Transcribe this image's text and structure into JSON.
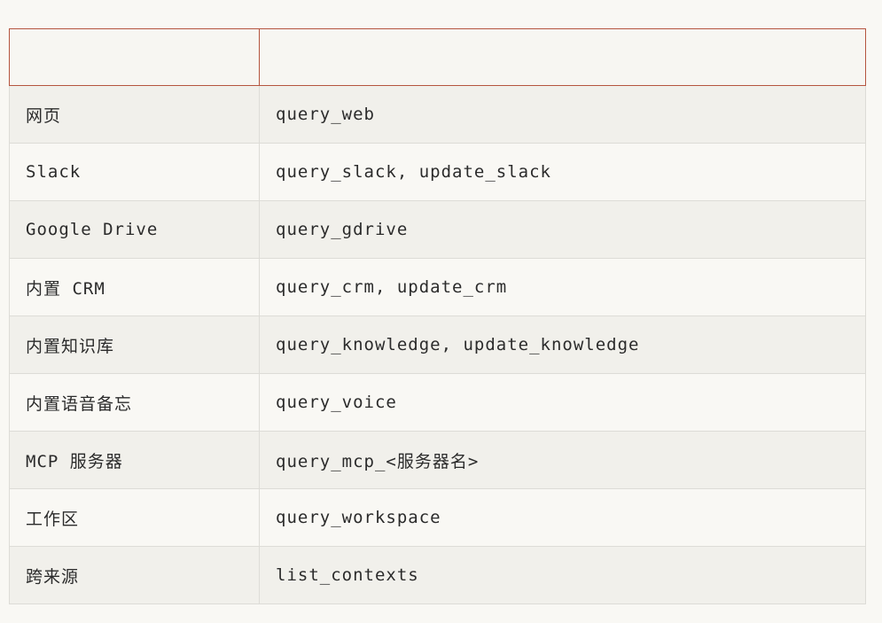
{
  "table": {
    "headers": [
      "",
      ""
    ],
    "rows": [
      {
        "source": "网页",
        "tools": "query_web"
      },
      {
        "source": "Slack",
        "tools": "query_slack, update_slack"
      },
      {
        "source": "Google Drive",
        "tools": "query_gdrive"
      },
      {
        "source": "内置 CRM",
        "tools": "query_crm, update_crm"
      },
      {
        "source": "内置知识库",
        "tools": "query_knowledge, update_knowledge"
      },
      {
        "source": "内置语音备忘",
        "tools": "query_voice"
      },
      {
        "source": "MCP 服务器",
        "tools": "query_mcp_<服务器名>"
      },
      {
        "source": "工作区",
        "tools": "query_workspace"
      },
      {
        "source": "跨来源",
        "tools": "list_contexts"
      }
    ]
  }
}
